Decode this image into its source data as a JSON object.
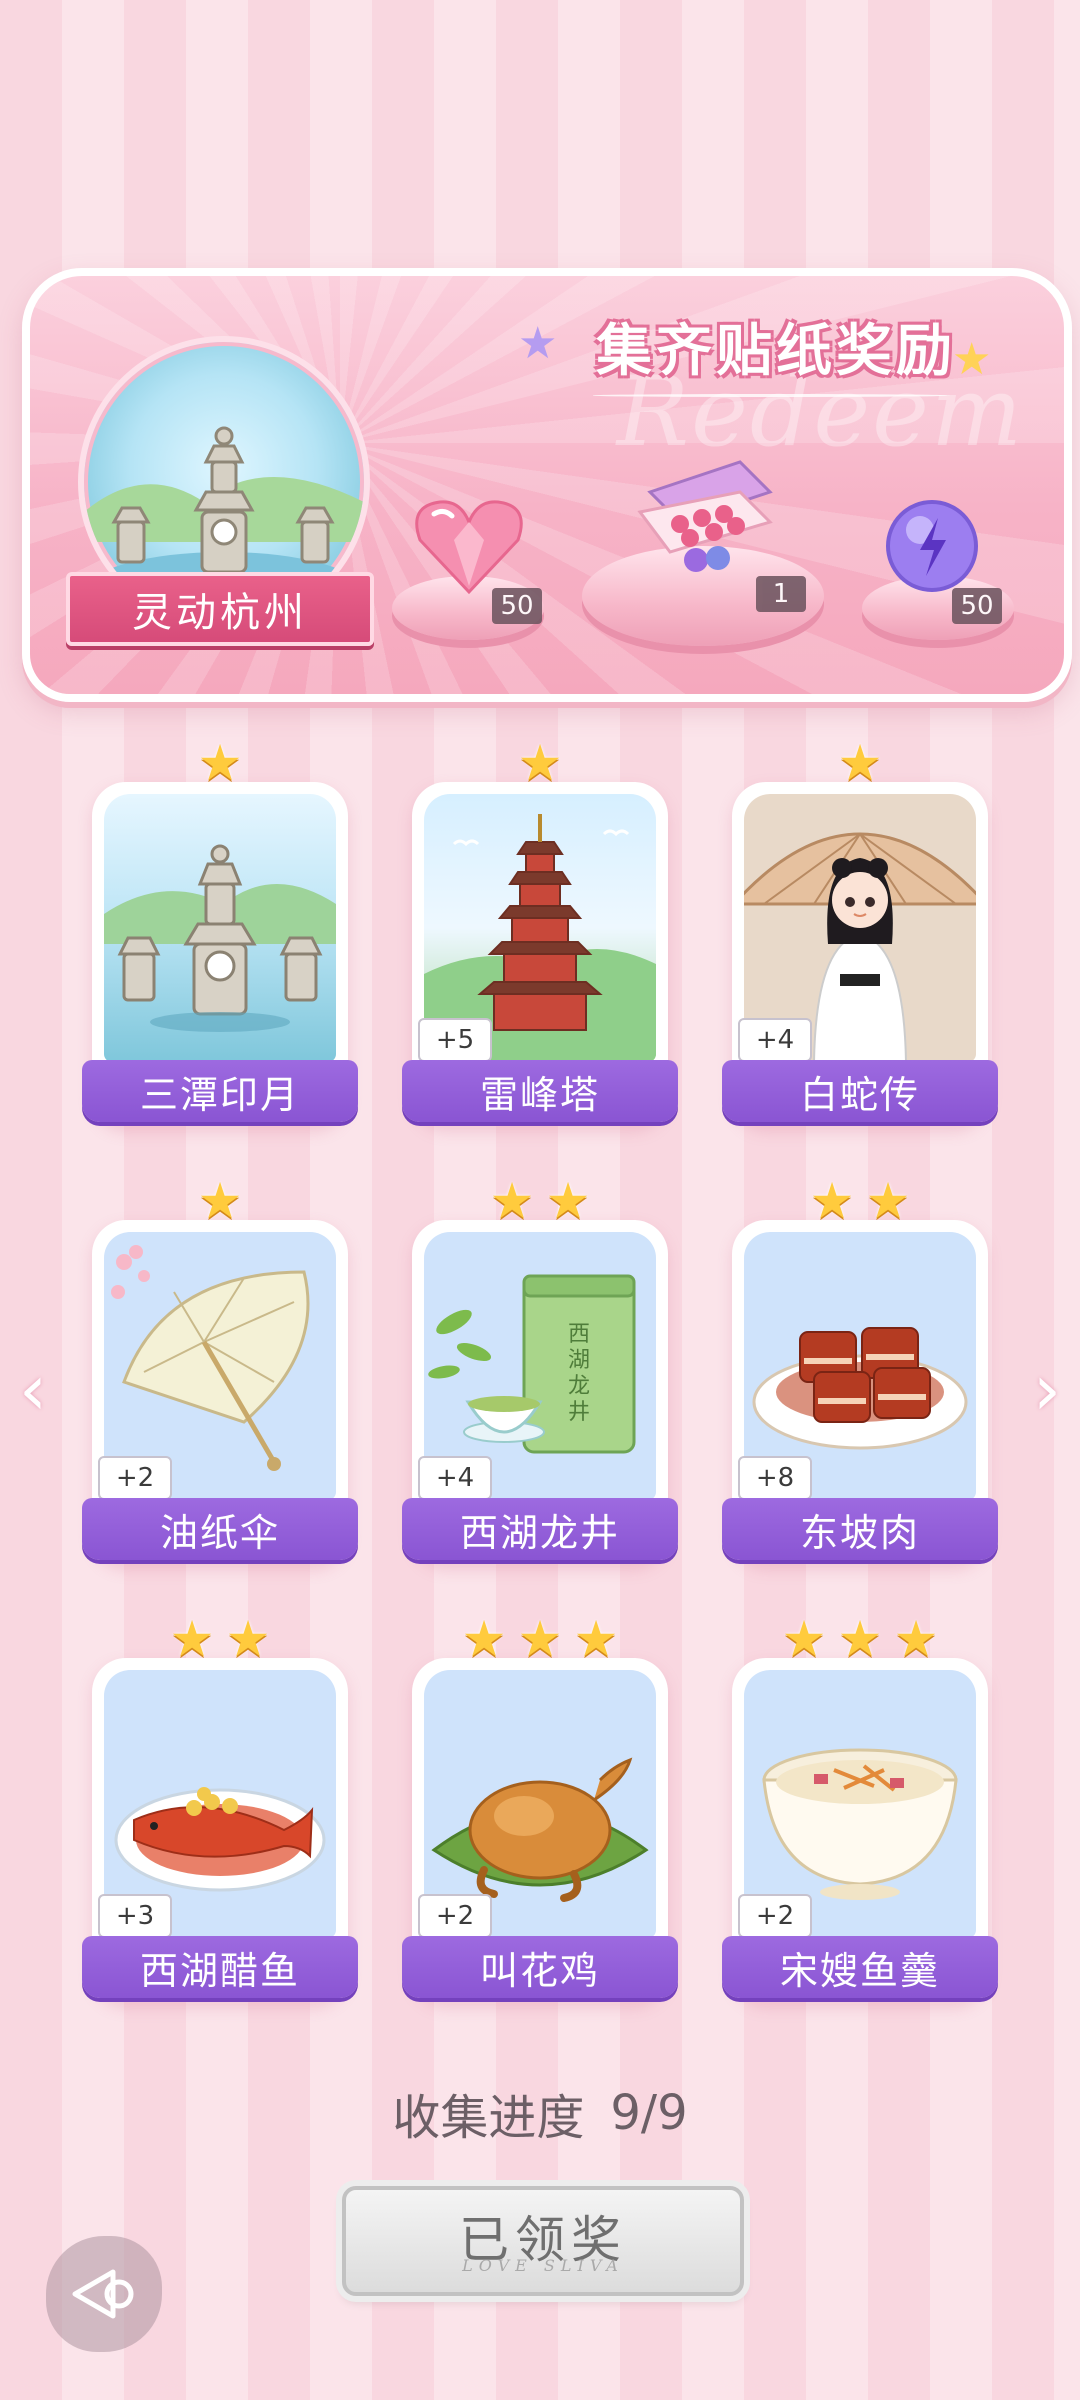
{
  "banner": {
    "title": "集齐贴纸奖励",
    "watermark": "Redeem",
    "city_name": "灵动杭州",
    "rewards": [
      {
        "icon": "pink-heart-gem-icon",
        "count": "50"
      },
      {
        "icon": "gift-box-icon",
        "count": "1"
      },
      {
        "icon": "purple-energy-orb-icon",
        "count": "50"
      }
    ]
  },
  "cards": [
    {
      "label": "三潭印月",
      "stars": 1,
      "bonus": "",
      "icon": "three-pools-pagoda"
    },
    {
      "label": "雷峰塔",
      "stars": 1,
      "bonus": "+5",
      "icon": "leifeng-pagoda"
    },
    {
      "label": "白蛇传",
      "stars": 1,
      "bonus": "+4",
      "icon": "white-snake-girl"
    },
    {
      "label": "油纸伞",
      "stars": 1,
      "bonus": "+2",
      "icon": "oil-paper-umbrella"
    },
    {
      "label": "西湖龙井",
      "stars": 2,
      "bonus": "+4",
      "icon": "longjing-tea",
      "tea_text": "西湖龙井"
    },
    {
      "label": "东坡肉",
      "stars": 2,
      "bonus": "+8",
      "icon": "dongpo-pork"
    },
    {
      "label": "西湖醋鱼",
      "stars": 2,
      "bonus": "+3",
      "icon": "vinegar-fish"
    },
    {
      "label": "叫花鸡",
      "stars": 3,
      "bonus": "+2",
      "icon": "beggars-chicken"
    },
    {
      "label": "宋嫂鱼羹",
      "stars": 3,
      "bonus": "+2",
      "icon": "fish-soup"
    }
  ],
  "progress": {
    "label": "收集进度",
    "value": "9/9"
  },
  "claim_button": {
    "label": "已领奖",
    "sub": "LOVE SLIVA"
  },
  "colors": {
    "accent_purple": "#8a55d3",
    "banner_pink": "#f7b3c7",
    "star_gold": "#ffcb3d"
  }
}
